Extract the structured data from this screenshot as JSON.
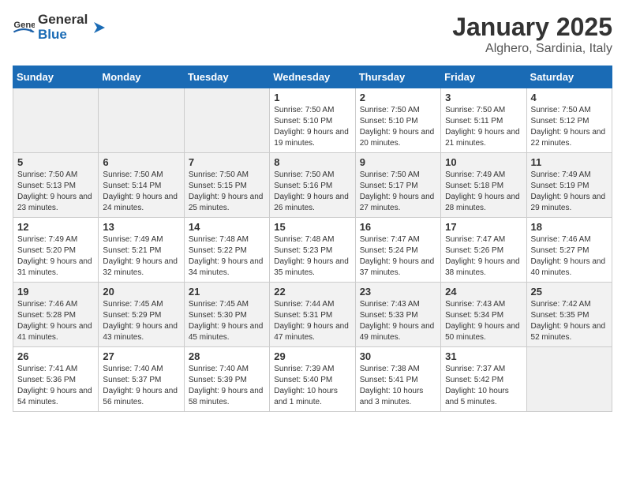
{
  "header": {
    "logo_general": "General",
    "logo_blue": "Blue",
    "title": "January 2025",
    "location": "Alghero, Sardinia, Italy"
  },
  "weekdays": [
    "Sunday",
    "Monday",
    "Tuesday",
    "Wednesday",
    "Thursday",
    "Friday",
    "Saturday"
  ],
  "weeks": [
    [
      {
        "day": "",
        "sunrise": "",
        "sunset": "",
        "daylight": ""
      },
      {
        "day": "",
        "sunrise": "",
        "sunset": "",
        "daylight": ""
      },
      {
        "day": "",
        "sunrise": "",
        "sunset": "",
        "daylight": ""
      },
      {
        "day": "1",
        "sunrise": "Sunrise: 7:50 AM",
        "sunset": "Sunset: 5:10 PM",
        "daylight": "Daylight: 9 hours and 19 minutes."
      },
      {
        "day": "2",
        "sunrise": "Sunrise: 7:50 AM",
        "sunset": "Sunset: 5:10 PM",
        "daylight": "Daylight: 9 hours and 20 minutes."
      },
      {
        "day": "3",
        "sunrise": "Sunrise: 7:50 AM",
        "sunset": "Sunset: 5:11 PM",
        "daylight": "Daylight: 9 hours and 21 minutes."
      },
      {
        "day": "4",
        "sunrise": "Sunrise: 7:50 AM",
        "sunset": "Sunset: 5:12 PM",
        "daylight": "Daylight: 9 hours and 22 minutes."
      }
    ],
    [
      {
        "day": "5",
        "sunrise": "Sunrise: 7:50 AM",
        "sunset": "Sunset: 5:13 PM",
        "daylight": "Daylight: 9 hours and 23 minutes."
      },
      {
        "day": "6",
        "sunrise": "Sunrise: 7:50 AM",
        "sunset": "Sunset: 5:14 PM",
        "daylight": "Daylight: 9 hours and 24 minutes."
      },
      {
        "day": "7",
        "sunrise": "Sunrise: 7:50 AM",
        "sunset": "Sunset: 5:15 PM",
        "daylight": "Daylight: 9 hours and 25 minutes."
      },
      {
        "day": "8",
        "sunrise": "Sunrise: 7:50 AM",
        "sunset": "Sunset: 5:16 PM",
        "daylight": "Daylight: 9 hours and 26 minutes."
      },
      {
        "day": "9",
        "sunrise": "Sunrise: 7:50 AM",
        "sunset": "Sunset: 5:17 PM",
        "daylight": "Daylight: 9 hours and 27 minutes."
      },
      {
        "day": "10",
        "sunrise": "Sunrise: 7:49 AM",
        "sunset": "Sunset: 5:18 PM",
        "daylight": "Daylight: 9 hours and 28 minutes."
      },
      {
        "day": "11",
        "sunrise": "Sunrise: 7:49 AM",
        "sunset": "Sunset: 5:19 PM",
        "daylight": "Daylight: 9 hours and 29 minutes."
      }
    ],
    [
      {
        "day": "12",
        "sunrise": "Sunrise: 7:49 AM",
        "sunset": "Sunset: 5:20 PM",
        "daylight": "Daylight: 9 hours and 31 minutes."
      },
      {
        "day": "13",
        "sunrise": "Sunrise: 7:49 AM",
        "sunset": "Sunset: 5:21 PM",
        "daylight": "Daylight: 9 hours and 32 minutes."
      },
      {
        "day": "14",
        "sunrise": "Sunrise: 7:48 AM",
        "sunset": "Sunset: 5:22 PM",
        "daylight": "Daylight: 9 hours and 34 minutes."
      },
      {
        "day": "15",
        "sunrise": "Sunrise: 7:48 AM",
        "sunset": "Sunset: 5:23 PM",
        "daylight": "Daylight: 9 hours and 35 minutes."
      },
      {
        "day": "16",
        "sunrise": "Sunrise: 7:47 AM",
        "sunset": "Sunset: 5:24 PM",
        "daylight": "Daylight: 9 hours and 37 minutes."
      },
      {
        "day": "17",
        "sunrise": "Sunrise: 7:47 AM",
        "sunset": "Sunset: 5:26 PM",
        "daylight": "Daylight: 9 hours and 38 minutes."
      },
      {
        "day": "18",
        "sunrise": "Sunrise: 7:46 AM",
        "sunset": "Sunset: 5:27 PM",
        "daylight": "Daylight: 9 hours and 40 minutes."
      }
    ],
    [
      {
        "day": "19",
        "sunrise": "Sunrise: 7:46 AM",
        "sunset": "Sunset: 5:28 PM",
        "daylight": "Daylight: 9 hours and 41 minutes."
      },
      {
        "day": "20",
        "sunrise": "Sunrise: 7:45 AM",
        "sunset": "Sunset: 5:29 PM",
        "daylight": "Daylight: 9 hours and 43 minutes."
      },
      {
        "day": "21",
        "sunrise": "Sunrise: 7:45 AM",
        "sunset": "Sunset: 5:30 PM",
        "daylight": "Daylight: 9 hours and 45 minutes."
      },
      {
        "day": "22",
        "sunrise": "Sunrise: 7:44 AM",
        "sunset": "Sunset: 5:31 PM",
        "daylight": "Daylight: 9 hours and 47 minutes."
      },
      {
        "day": "23",
        "sunrise": "Sunrise: 7:43 AM",
        "sunset": "Sunset: 5:33 PM",
        "daylight": "Daylight: 9 hours and 49 minutes."
      },
      {
        "day": "24",
        "sunrise": "Sunrise: 7:43 AM",
        "sunset": "Sunset: 5:34 PM",
        "daylight": "Daylight: 9 hours and 50 minutes."
      },
      {
        "day": "25",
        "sunrise": "Sunrise: 7:42 AM",
        "sunset": "Sunset: 5:35 PM",
        "daylight": "Daylight: 9 hours and 52 minutes."
      }
    ],
    [
      {
        "day": "26",
        "sunrise": "Sunrise: 7:41 AM",
        "sunset": "Sunset: 5:36 PM",
        "daylight": "Daylight: 9 hours and 54 minutes."
      },
      {
        "day": "27",
        "sunrise": "Sunrise: 7:40 AM",
        "sunset": "Sunset: 5:37 PM",
        "daylight": "Daylight: 9 hours and 56 minutes."
      },
      {
        "day": "28",
        "sunrise": "Sunrise: 7:40 AM",
        "sunset": "Sunset: 5:39 PM",
        "daylight": "Daylight: 9 hours and 58 minutes."
      },
      {
        "day": "29",
        "sunrise": "Sunrise: 7:39 AM",
        "sunset": "Sunset: 5:40 PM",
        "daylight": "Daylight: 10 hours and 1 minute."
      },
      {
        "day": "30",
        "sunrise": "Sunrise: 7:38 AM",
        "sunset": "Sunset: 5:41 PM",
        "daylight": "Daylight: 10 hours and 3 minutes."
      },
      {
        "day": "31",
        "sunrise": "Sunrise: 7:37 AM",
        "sunset": "Sunset: 5:42 PM",
        "daylight": "Daylight: 10 hours and 5 minutes."
      },
      {
        "day": "",
        "sunrise": "",
        "sunset": "",
        "daylight": ""
      }
    ]
  ]
}
